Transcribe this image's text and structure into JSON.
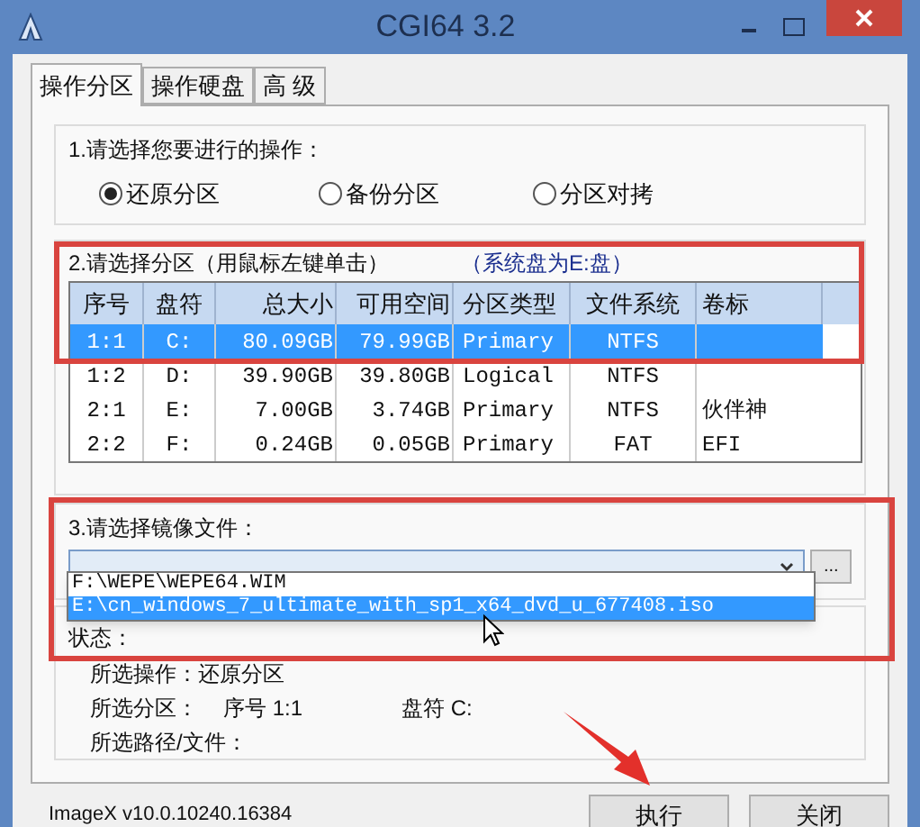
{
  "window": {
    "title": "CGI64  3.2"
  },
  "tabs": [
    {
      "label": "操作分区",
      "selected": true
    },
    {
      "label": "操作硬盘",
      "selected": false
    },
    {
      "label": "高 级",
      "selected": false
    }
  ],
  "operation": {
    "label": "1.请选择您要进行的操作：",
    "options": [
      {
        "label": "还原分区",
        "selected": true
      },
      {
        "label": "备份分区",
        "selected": false
      },
      {
        "label": "分区对拷",
        "selected": false
      }
    ]
  },
  "partition": {
    "label": "2.请选择分区（用鼠标左键单击）",
    "note": "（系统盘为E:盘）",
    "columns": [
      "序号",
      "盘符",
      "总大小",
      "可用空间",
      "分区类型",
      "文件系统",
      "卷标"
    ],
    "rows": [
      {
        "cells": [
          "1:1",
          "C:",
          "80.09GB",
          "79.99GB",
          "Primary",
          "NTFS",
          ""
        ],
        "selected": true
      },
      {
        "cells": [
          "1:2",
          "D:",
          "39.90GB",
          "39.80GB",
          "Logical",
          "NTFS",
          ""
        ],
        "selected": false
      },
      {
        "cells": [
          "2:1",
          "E:",
          "7.00GB",
          "3.74GB",
          "Primary",
          "NTFS",
          "伙伴神"
        ],
        "selected": false
      },
      {
        "cells": [
          "2:2",
          "F:",
          "0.24GB",
          "0.05GB",
          "Primary",
          "FAT",
          "EFI"
        ],
        "selected": false
      }
    ]
  },
  "image": {
    "label": "3.请选择镜像文件：",
    "browse_button": "...",
    "options": [
      {
        "label": "F:\\WEPE\\WEPE64.WIM",
        "selected": false
      },
      {
        "label": "E:\\cn_windows_7_ultimate_with_sp1_x64_dvd_u_677408.iso",
        "selected": true
      }
    ]
  },
  "status": {
    "label": "状态：",
    "operation": "所选操作：还原分区",
    "partition_label": "所选分区：",
    "index": "序号 1:1",
    "drive": "盘符 C:",
    "path_label": "所选路径/文件："
  },
  "footer": {
    "version": "ImageX v10.0.10240.16384",
    "buttons": [
      "执行",
      "关闭"
    ]
  }
}
